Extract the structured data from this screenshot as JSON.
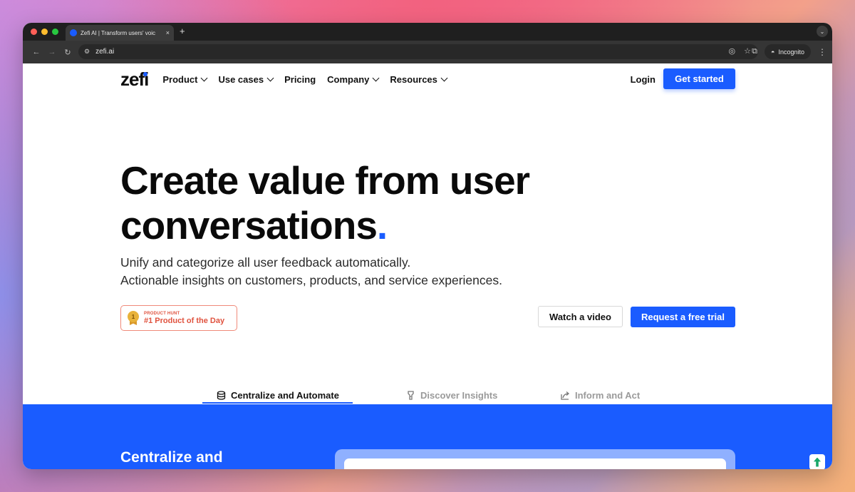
{
  "browser": {
    "tab_title": "Zefi AI | Transform users' voic",
    "tab_close": "×",
    "new_tab": "+",
    "url": "zefi.ai",
    "incognito_label": "Incognito"
  },
  "nav": {
    "logo": "zefi",
    "menu": [
      {
        "label": "Product",
        "dropdown": true
      },
      {
        "label": "Use cases",
        "dropdown": true
      },
      {
        "label": "Pricing",
        "dropdown": false
      },
      {
        "label": "Company",
        "dropdown": true
      },
      {
        "label": "Resources",
        "dropdown": true
      }
    ],
    "login": "Login",
    "get_started": "Get started"
  },
  "hero": {
    "title_line1": "Create value from user",
    "title_line2": "conversations",
    "title_dot": ".",
    "subtitle_line1": "Unify and categorize all user feedback automatically.",
    "subtitle_line2": "Actionable insights on customers, products, and service experiences.",
    "badge_small": "PRODUCT HUNT",
    "badge_big": "#1 Product of the Day",
    "badge_medal": "1",
    "watch_video": "Watch a video",
    "request_trial": "Request a free trial"
  },
  "feature_tabs": [
    {
      "label": "Centralize and Automate",
      "icon": "database-icon",
      "active": true
    },
    {
      "label": "Discover Insights",
      "icon": "flashlight-icon",
      "active": false
    },
    {
      "label": "Inform and Act",
      "icon": "share-arrow-icon",
      "active": false
    }
  ],
  "section": {
    "title": "Centralize and"
  },
  "colors": {
    "brand_blue": "#1a5cff",
    "badge_red": "#e0523e"
  }
}
